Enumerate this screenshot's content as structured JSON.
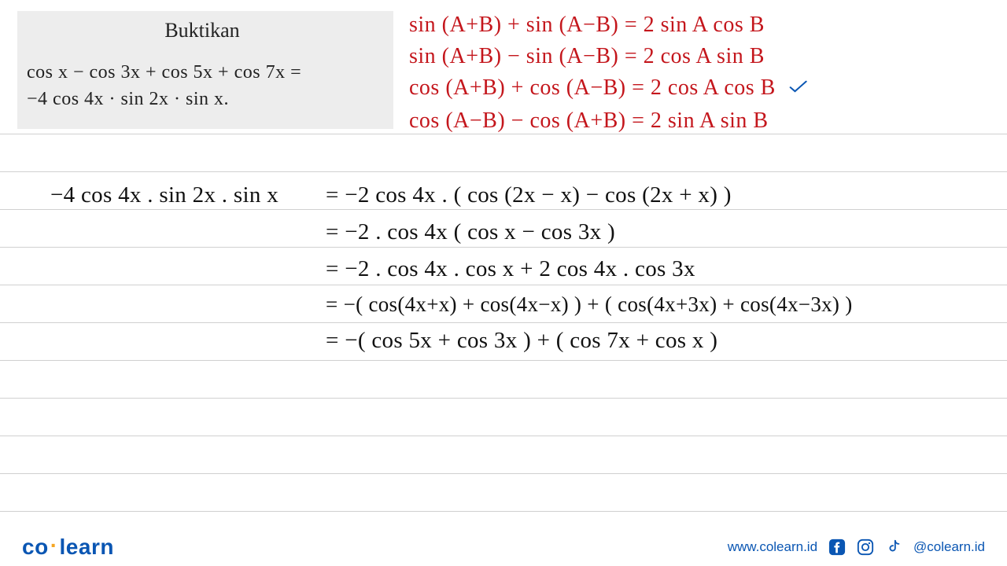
{
  "problem": {
    "title": "Buktikan",
    "line1": "cos x − cos 3x + cos 5x + cos 7x =",
    "line2": "−4 cos 4x · sin 2x · sin x."
  },
  "identities": {
    "row1": "sin (A+B) + sin (A−B) = 2 sin A cos B",
    "row2": "sin (A+B) − sin (A−B) = 2 cos A sin B",
    "row3": "cos (A+B) + cos (A−B) = 2 cos A cos B",
    "row4": "cos (A−B) − cos (A+B) = 2 sin A sin B"
  },
  "work": {
    "lhs": "−4 cos 4x . sin 2x . sin x",
    "r1": "=  −2 cos 4x . ( cos (2x − x) − cos (2x + x) )",
    "r2": "= −2 . cos 4x ( cos x − cos 3x )",
    "r3": "= −2 . cos 4x . cos x + 2 cos 4x . cos 3x",
    "r4": "= −( cos(4x+x) + cos(4x−x) ) + ( cos(4x+3x) + cos(4x−3x) )",
    "r5": "= −( cos 5x + cos 3x ) + ( cos 7x + cos x )"
  },
  "footer": {
    "brand_co": "co",
    "brand_learn": "learn",
    "url": "www.colearn.id",
    "handle": "@colearn.id"
  }
}
